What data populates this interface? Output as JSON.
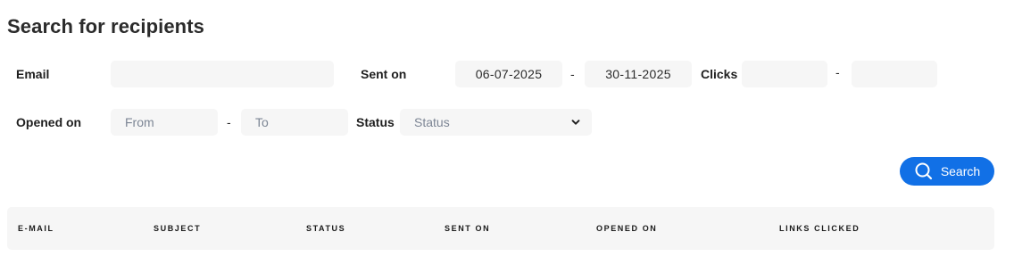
{
  "page_title": "Search for recipients",
  "filters": {
    "email": {
      "label": "Email",
      "value": ""
    },
    "sent_on": {
      "label": "Sent on",
      "from": "06-07-2025",
      "separator": "-",
      "to": "30-11-2025"
    },
    "clicks": {
      "label": "Clicks",
      "from": "",
      "separator": "-",
      "to": ""
    },
    "opened_on": {
      "label": "Opened on",
      "from_placeholder": "From",
      "separator": "-",
      "to_placeholder": "To"
    },
    "status": {
      "label": "Status",
      "placeholder": "Status"
    }
  },
  "actions": {
    "search_label": "Search"
  },
  "table": {
    "columns": [
      "E-MAIL",
      "SUBJECT",
      "STATUS",
      "SENT ON",
      "OPENED ON",
      "LINKS CLICKED"
    ]
  },
  "colors": {
    "accent": "#1170e6",
    "field_bg": "#f6f6f6",
    "placeholder": "#7c8594"
  },
  "icons": {
    "search_button": "search-icon",
    "status_select": "chevron-down-icon"
  }
}
